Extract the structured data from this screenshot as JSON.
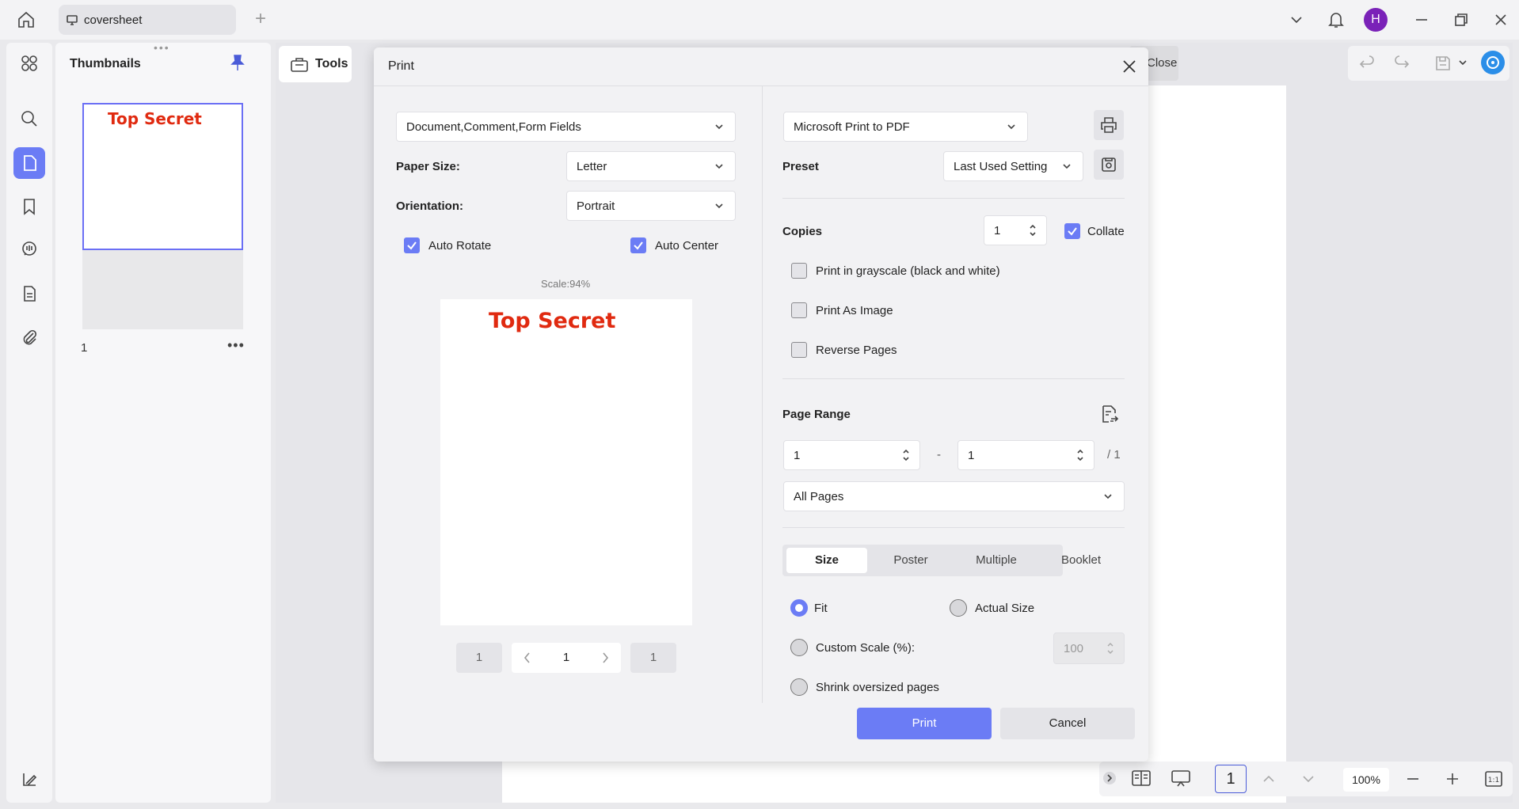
{
  "tab": {
    "title": "coversheet"
  },
  "user": {
    "initial": "H"
  },
  "thumbnails": {
    "title": "Thumbnails",
    "page_number": "1"
  },
  "document": {
    "preview_text": "Top Secret"
  },
  "toolbar": {
    "tools_label": "Tools",
    "close_label": "Close"
  },
  "bottom": {
    "current_page": "1",
    "zoom": "100%"
  },
  "dialog": {
    "title": "Print",
    "content_select": "Document,Comment,Form Fields",
    "paper_size_label": "Paper Size:",
    "paper_size": "Letter",
    "orientation_label": "Orientation:",
    "orientation": "Portrait",
    "auto_rotate": "Auto Rotate",
    "auto_center": "Auto Center",
    "scale": "Scale:94%",
    "preview_first": "1",
    "preview_current": "1",
    "preview_last": "1",
    "printer": "Microsoft Print to PDF",
    "preset_label": "Preset",
    "preset": "Last Used Setting",
    "copies_label": "Copies",
    "copies": "1",
    "collate": "Collate",
    "grayscale": "Print in grayscale (black and white)",
    "as_image": "Print As Image",
    "reverse": "Reverse Pages",
    "page_range_label": "Page Range",
    "range_from": "1",
    "range_dash": "-",
    "range_to": "1",
    "range_total": "/ 1",
    "range_select": "All Pages",
    "tabs": [
      "Size",
      "Poster",
      "Multiple",
      "Booklet"
    ],
    "fit": "Fit",
    "actual_size": "Actual Size",
    "custom_scale": "Custom Scale (%):",
    "custom_scale_value": "100",
    "shrink": "Shrink oversized pages",
    "print_button": "Print",
    "cancel_button": "Cancel"
  },
  "colors": {
    "accent": "#6b7cf5",
    "secret_red": "#e02a10",
    "avatar": "#7a22b8"
  }
}
